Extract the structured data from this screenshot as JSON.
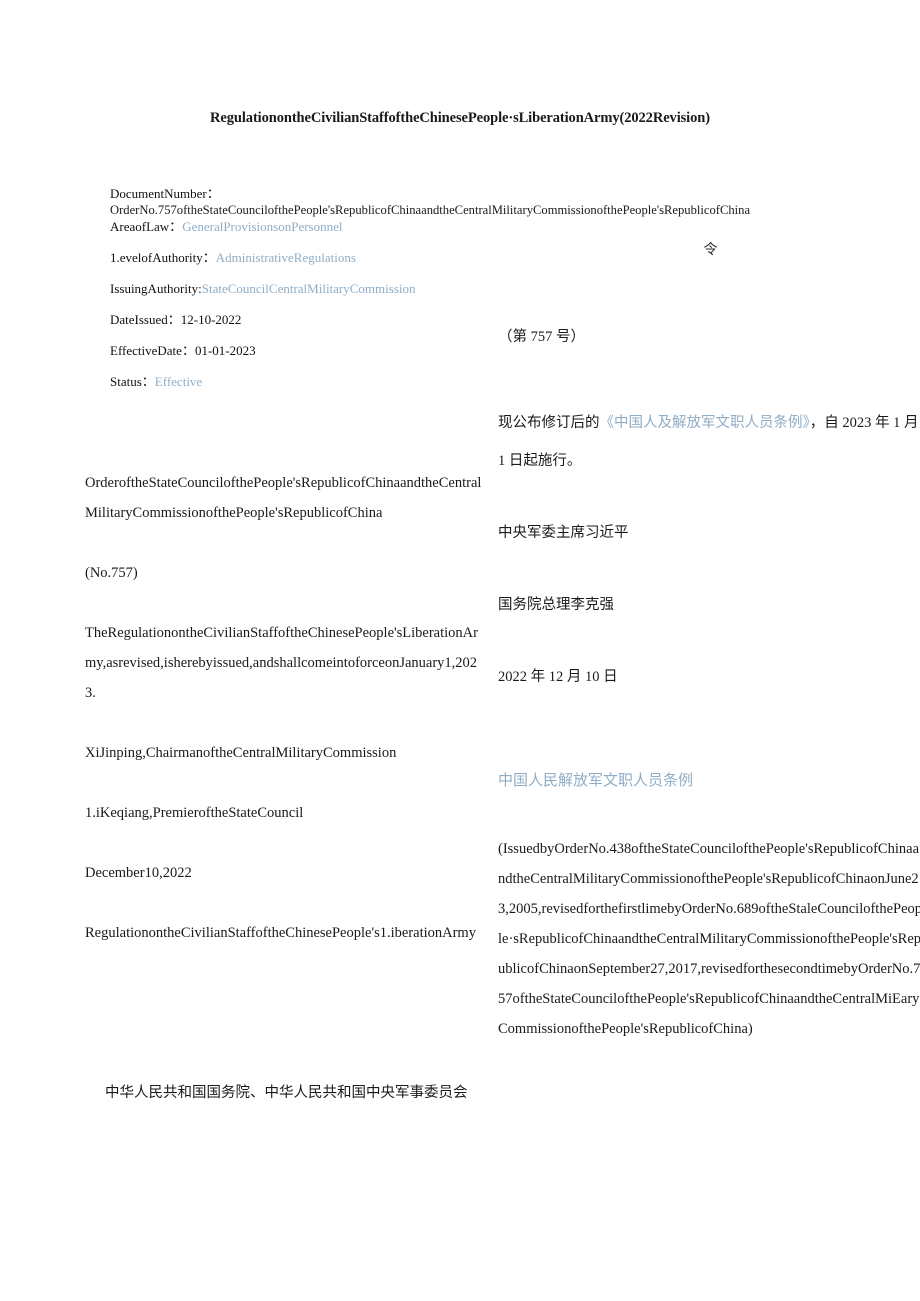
{
  "document": {
    "title": "RegulationontheCivilianStaffoftheChinesePeople·sLiberationArmy(2022Revision)"
  },
  "metadata": {
    "document_number_label": "DocumentNumber：",
    "document_number_value": "OrderNo.757oftheStateCouncilofthePeople'sRepublicofChinaandtheCentralMilitaryCommissionofthePeople'sRepublicofChina",
    "area_of_law_label": "AreaofLaw：",
    "area_of_law_value": "GeneralProvisionsonPersonnel",
    "level_of_authority_label": "1.evelofAuthority：",
    "level_of_authority_value": "AdministrativeRegulations",
    "issuing_authority_label": "IssuingAuthority:",
    "issuing_authority_value": "StateCouncilCentralMilitaryCommission",
    "date_issued_label": "DateIssued：",
    "date_issued_value": "12-10-2022",
    "effective_date_label": "EffectiveDate：",
    "effective_date_value": "01-01-2023",
    "status_label": "Status：",
    "status_value": "Effective"
  },
  "left_column": {
    "order_heading": "OrderoftheStateCouncilofthePeople'sRepublicofChinaandtheCentralMilitaryCommissionofthePeople'sRepublicofChina",
    "order_number": "(No.757)",
    "issuance_statement": "TheRegulationontheCivilianStaffoftheChinesePeople'sLiberationArmy,asrevised,isherebyissued,andshallcomeintoforceonJanuary1,2023.",
    "signatory_chairman": "XiJinping,ChairmanoftheCentralMilitaryCommission",
    "signatory_premier": "1.iKeqiang,PremieroftheStateCouncil",
    "signature_date": "December10,2022",
    "regulation_heading": "RegulationontheCivilianStaffoftheChinesePeople's1.iberationArmy",
    "chinese_issuers": "中华人民共和国国务院、中华人民共和国中央军事委员会"
  },
  "right_column": {
    "order_glyph": "令",
    "order_number_cn": "（第 757 号）",
    "promulgation_text_before": "现公布修订后的",
    "promulgation_link": "《中国人及解放军文职人员条例》",
    "promulgation_text_after": "，自 2023 年 1 月 1 日起施行。",
    "signatory_chairman_cn": "中央军委主席习近平",
    "signatory_premier_cn": "国务院总理李克强",
    "signature_date_cn": "2022 年 12 月 10 日",
    "regulation_title_cn": "中国人民解放军文职人员条例",
    "revision_history": "(IssuedbyOrderNo.438oftheStateCouncilofthePeople'sRepublicofChinaandtheCentralMilitaryCommissionofthePeople'sRepublicofChinaonJune23,2005,revisedforthefirstlimebyOrderNo.689oftheStaleCouncilofthePeople·sRepublicofChinaandtheCentralMilitaryCommissionofthePeople'sRepublicofChinaonSeptember27,2017,revisedforthesecondtimebyOrderNo.757oftheStateCouncilofthePeople'sRepublicofChinaandtheCentralMiEaryCommissionofthePeople'sRepublicofChina)"
  },
  "colors": {
    "link_blue": "#8fadc6",
    "body_text": "#1a1a1a",
    "page_background": "#ffffff"
  }
}
